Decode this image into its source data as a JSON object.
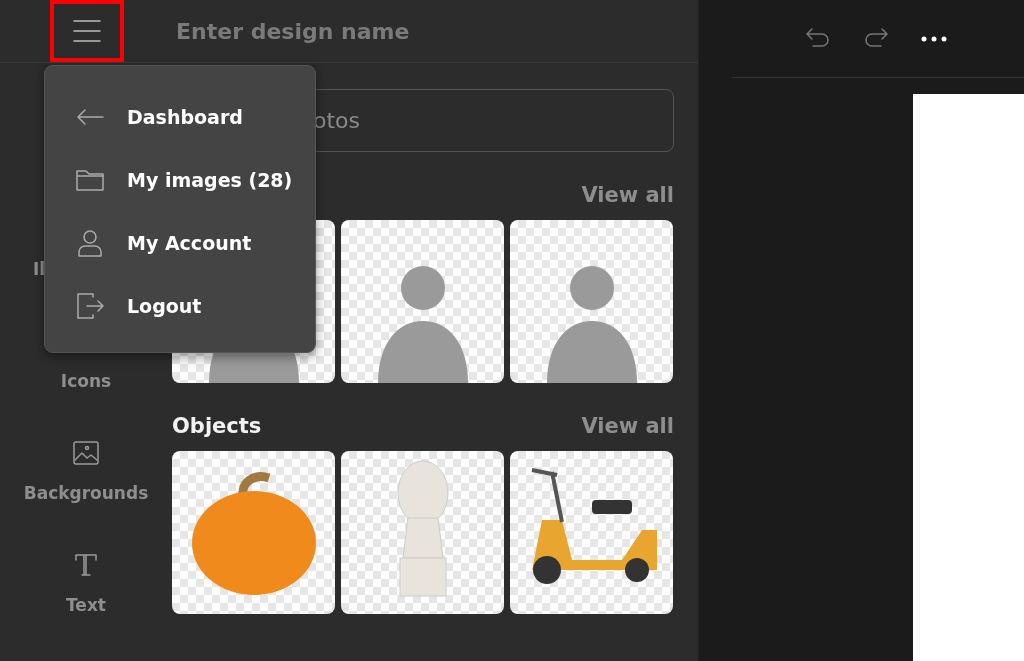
{
  "header": {
    "design_name_placeholder": "Enter design name"
  },
  "menu": {
    "items": [
      {
        "kind": "back",
        "label": "Dashboard"
      },
      {
        "kind": "folder",
        "label": "My images (28)"
      },
      {
        "kind": "user",
        "label": "My Account"
      },
      {
        "kind": "logout",
        "label": "Logout"
      }
    ]
  },
  "sidebar": {
    "items": [
      {
        "kind": "illustrations",
        "label": "Il"
      },
      {
        "kind": "icons",
        "label": "Icons"
      },
      {
        "kind": "image",
        "label": "Backgrounds"
      },
      {
        "kind": "text",
        "label": "Text"
      }
    ]
  },
  "search": {
    "placeholder": "otos"
  },
  "sections": [
    {
      "link": "View all",
      "items": [
        {
          "kind": "person"
        },
        {
          "kind": "person"
        },
        {
          "kind": "person"
        }
      ]
    },
    {
      "title": "Objects",
      "link": "View all",
      "items": [
        {
          "kind": "pumpkin"
        },
        {
          "kind": "bust"
        },
        {
          "kind": "scooter"
        }
      ]
    }
  ]
}
